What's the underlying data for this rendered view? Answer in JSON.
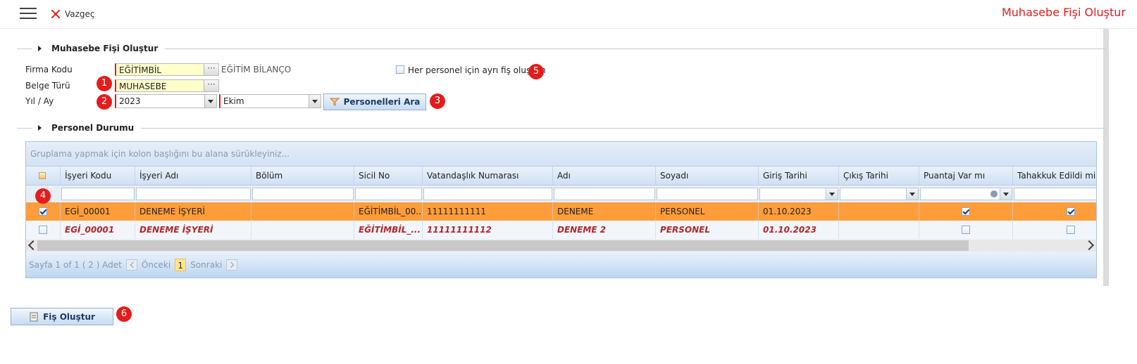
{
  "topbar": {
    "cancel_label": "Vazgeç",
    "page_title": "Muhasebe Fişi Oluştur"
  },
  "form_section": {
    "title": "Muhasebe Fişi Oluştur",
    "firma_label": "Firma Kodu",
    "firma_value": "EĞİTİMBİL",
    "firma_desc": "EĞİTİM BİLANÇO",
    "belge_label": "Belge Türü",
    "belge_value": "MUHASEBE",
    "yil_ay_label": "Yıl / Ay",
    "yil_value": "2023",
    "ay_value": "Ekim",
    "search_button": "Personelleri Ara",
    "separate_label": "Her personel için ayrı fiş oluşsun",
    "separate_checked": false,
    "lookup_glyph": "···"
  },
  "status_section": {
    "title": "Personel Durumu"
  },
  "grid": {
    "group_hint": "Gruplama yapmak için kolon başlığını bu alana sürükleyiniz...",
    "columns": [
      "İşyeri Kodu",
      "İşyeri Adı",
      "Bölüm",
      "Sicil No",
      "Vatandaşlık Numarası",
      "Adı",
      "Soyadı",
      "Giriş Tarihi",
      "Çıkış Tarihi",
      "Puantaj Var mı",
      "Tahakkuk Edildi mi"
    ],
    "rows": [
      {
        "selected": true,
        "isyeri_kodu": "EGİ_00001",
        "isyeri_adi": "DENEME İŞYERİ",
        "bolum": "",
        "sicil_no": "EĞİTİMBİL_00...",
        "tc": "11111111111",
        "adi": "DENEME",
        "soyadi": "PERSONEL",
        "giris": "01.10.2023",
        "cikis": "",
        "puantaj": true,
        "tahakkuk": true
      },
      {
        "selected": false,
        "isyeri_kodu": "EGİ_00001",
        "isyeri_adi": "DENEME İŞYERİ",
        "bolum": "",
        "sicil_no": "EĞİTİMBİL_...",
        "tc": "11111111112",
        "adi": "DENEME 2",
        "soyadi": "PERSONEL",
        "giris": "01.10.2023",
        "cikis": "",
        "puantaj": false,
        "tahakkuk": false
      }
    ],
    "pager": {
      "info": "Sayfa 1 of 1 ( 2 ) Adet",
      "prev": "Önceki",
      "page": "1",
      "next": "Sonraki"
    }
  },
  "bottom": {
    "create_button": "Fiş Oluştur"
  },
  "badges": {
    "b1": "1",
    "b2": "2",
    "b3": "3",
    "b4": "4",
    "b5": "5",
    "b6": "6"
  },
  "colors": {
    "accent_red": "#e31c1c",
    "selected_row": "#ff9d3a",
    "grid_blue": "#cfe0f4"
  }
}
